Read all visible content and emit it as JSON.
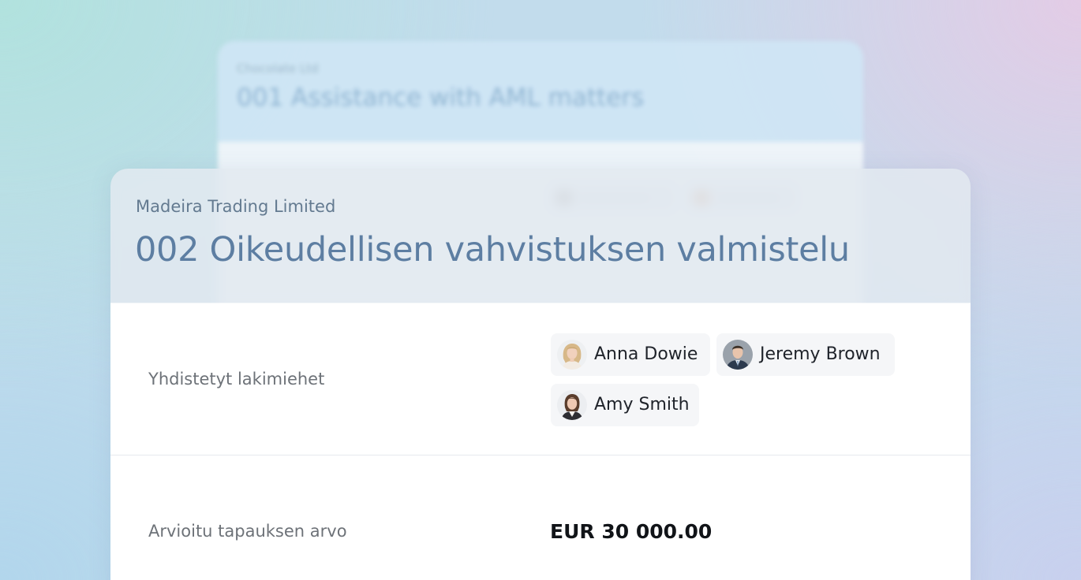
{
  "background_card": {
    "company": "Chocolate Ltd",
    "title": "001 Assistance with AML matters"
  },
  "case": {
    "company": "Madeira Trading Limited",
    "title": "002 Oikeudellisen vahvistuksen valmistelu"
  },
  "fields": {
    "lawyers": {
      "label": "Yhdistetyt lakimiehet",
      "people": [
        {
          "name": "Anna Dowie",
          "avatar": "avatar-blonde-woman"
        },
        {
          "name": "Jeremy Brown",
          "avatar": "avatar-man-suit"
        },
        {
          "name": "Amy Smith",
          "avatar": "avatar-dark-haired-woman"
        }
      ]
    },
    "estimated_value": {
      "label": "Arvioitu tapauksen arvo",
      "value": "EUR 30 000.00"
    }
  }
}
